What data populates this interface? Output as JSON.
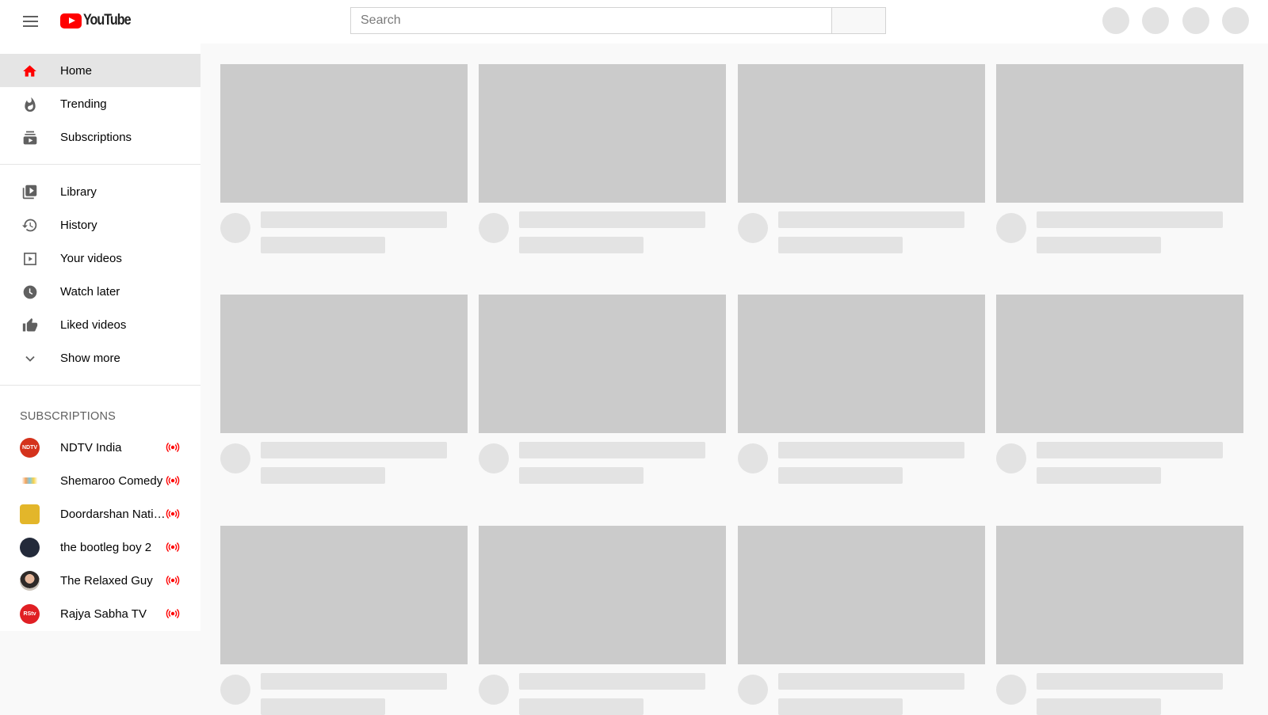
{
  "header": {
    "logo_text": "YouTube",
    "search_placeholder": "Search",
    "search_value": "",
    "header_buttons": [
      "apps-placeholder",
      "notifications-placeholder",
      "settings-placeholder",
      "account-placeholder"
    ]
  },
  "sidebar": {
    "primary": [
      {
        "label": "Home",
        "icon": "home-icon",
        "active": true
      },
      {
        "label": "Trending",
        "icon": "trending-flame-icon",
        "active": false
      },
      {
        "label": "Subscriptions",
        "icon": "subscriptions-icon",
        "active": false
      }
    ],
    "secondary": [
      {
        "label": "Library",
        "icon": "library-icon"
      },
      {
        "label": "History",
        "icon": "history-icon"
      },
      {
        "label": "Your videos",
        "icon": "your-videos-icon"
      },
      {
        "label": "Watch later",
        "icon": "watch-later-clock-icon"
      },
      {
        "label": "Liked videos",
        "icon": "thumbs-up-icon"
      },
      {
        "label": "Show more",
        "icon": "chevron-down-icon"
      }
    ],
    "subscriptions_title": "SUBSCRIPTIONS",
    "subscriptions": [
      {
        "name": "NDTV India",
        "live": true,
        "avatar_color": "#d4321c",
        "avatar_text": "NDTV"
      },
      {
        "name": "Shemaroo Comedy",
        "live": true,
        "avatar_color": "#ffffff",
        "avatar_text": ""
      },
      {
        "name": "Doordarshan National",
        "live": true,
        "avatar_color": "#e3b62a",
        "avatar_text": ""
      },
      {
        "name": "the bootleg boy 2",
        "live": true,
        "avatar_color": "#232a3a",
        "avatar_text": ""
      },
      {
        "name": "The Relaxed Guy",
        "live": true,
        "avatar_color": "#8a6a55",
        "avatar_text": ""
      },
      {
        "name": "Rajya Sabha TV",
        "live": true,
        "avatar_color": "#e01f24",
        "avatar_text": "RStv"
      }
    ],
    "live_color": "#ff0000",
    "accent_color": "#ff0000"
  },
  "main": {
    "skeleton_rows": 3,
    "skeleton_columns": 4,
    "thumb_color": "#cbcbcb",
    "line_color": "#e3e3e3"
  }
}
